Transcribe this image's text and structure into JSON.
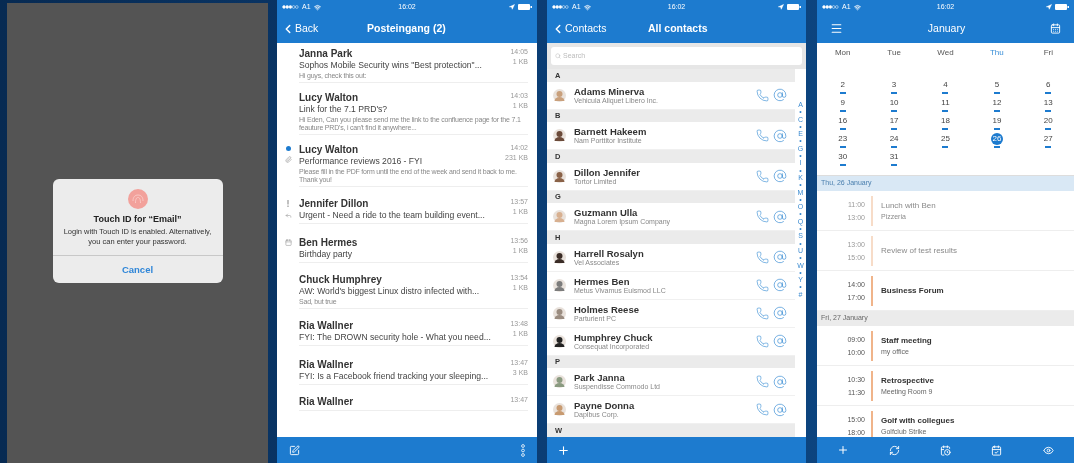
{
  "touch_id_dialog": {
    "title": "Touch ID for “Email”",
    "message": "Login with Touch ID is enabled. Alternatively, you can enter your password.",
    "button": "Cancel"
  },
  "mail": {
    "status_bar": {
      "carrier": "A1",
      "time": "16:02"
    },
    "back": "Back",
    "title": "Posteingang (2)",
    "messages": [
      {
        "sender": "Janna Park",
        "subject": "Sophos Mobile Security wins \"Best protection\"...",
        "preview": "Hi guys, check this out:",
        "time": "14:05",
        "size": "1 KB",
        "unread": false,
        "important": false,
        "attachment": false,
        "replied": false,
        "invitation": false
      },
      {
        "sender": "Lucy Walton",
        "subject": "Link for the 7.1 PRD's?",
        "preview": "Hi Eden, Can you please send me the link to the confluence page for the 7.1 feauture PRD's, i can't find it anywhere...",
        "time": "14:03",
        "size": "1 KB",
        "unread": false,
        "important": false,
        "attachment": false,
        "replied": false,
        "invitation": false
      },
      {
        "sender": "Lucy Walton",
        "subject": "Performance reviews 2016 - FYI",
        "preview": "Please fill in the PDF form until the end of the week and send it back to me. Thank you!",
        "time": "14:02",
        "size": "231 KB",
        "unread": true,
        "important": false,
        "attachment": true,
        "replied": false,
        "invitation": false
      },
      {
        "sender": "Jennifer Dillon",
        "subject": "Urgent - Need a ride to the team building event...",
        "time": "13:57",
        "size": "1 KB",
        "unread": false,
        "important": true,
        "attachment": false,
        "replied": true,
        "invitation": false
      },
      {
        "sender": "Ben Hermes",
        "subject": "Birthday party",
        "time": "13:56",
        "size": "1 KB",
        "unread": false,
        "important": false,
        "attachment": false,
        "replied": false,
        "invitation": true
      },
      {
        "sender": "Chuck Humphrey",
        "subject": "AW: World's biggest Linux distro infected with...",
        "preview": "Sad, but true",
        "time": "13:54",
        "size": "1 KB",
        "unread": false,
        "important": false,
        "attachment": false,
        "replied": false,
        "invitation": false
      },
      {
        "sender": "Ria Wallner",
        "subject": "FYI: The DROWN security hole - What you need...",
        "time": "13:48",
        "size": "1 KB",
        "unread": false,
        "important": false,
        "attachment": false,
        "replied": false,
        "invitation": false
      },
      {
        "sender": "Ria Wallner",
        "subject": "FYI: Is a Facebook friend tracking your sleeping...",
        "time": "13:47",
        "size": "3 KB",
        "unread": false,
        "important": false,
        "attachment": false,
        "replied": false,
        "invitation": false
      },
      {
        "sender": "Ria Wallner",
        "time": "13:47",
        "unread": false,
        "important": false,
        "attachment": false,
        "replied": false,
        "invitation": false
      }
    ]
  },
  "contacts": {
    "status_bar": {
      "carrier": "A1",
      "time": "16:02"
    },
    "back": "Contacts",
    "title": "All contacts",
    "search": {
      "placeholder": "Search"
    },
    "sections": [
      {
        "letter": "A",
        "contacts": [
          {
            "name": "Adams Minerva",
            "company": "Vehicula Aliquet Libero Inc."
          }
        ]
      },
      {
        "letter": "B",
        "contacts": [
          {
            "name": "Barnett Hakeem",
            "company": "Nam Porttitor Institute"
          }
        ]
      },
      {
        "letter": "D",
        "contacts": [
          {
            "name": "Dillon Jennifer",
            "company": "Tortor Limited"
          }
        ]
      },
      {
        "letter": "G",
        "contacts": [
          {
            "name": "Guzmann Ulla",
            "company": "Magna Lorem Ipsum Company"
          }
        ]
      },
      {
        "letter": "H",
        "contacts": [
          {
            "name": "Harrell Rosalyn",
            "company": "Vel Associates"
          },
          {
            "name": "Hermes Ben",
            "company": "Metus Vivamus Euismod LLC"
          },
          {
            "name": "Holmes Reese",
            "company": "Parturient PC"
          },
          {
            "name": "Humphrey Chuck",
            "company": "Consequat Incorporated"
          }
        ]
      },
      {
        "letter": "P",
        "contacts": [
          {
            "name": "Park Janna",
            "company": "Suspendisse Commodo Ltd"
          },
          {
            "name": "Payne Donna",
            "company": "Dapibus Corp."
          }
        ]
      },
      {
        "letter": "W"
      }
    ],
    "index": [
      "A",
      "•",
      "C",
      "•",
      "E",
      "•",
      "G",
      "•",
      "I",
      "•",
      "K",
      "•",
      "M",
      "•",
      "O",
      "•",
      "Q",
      "•",
      "S",
      "•",
      "U",
      "•",
      "W",
      "•",
      "Y",
      "•",
      "#"
    ]
  },
  "calendar": {
    "status_bar": {
      "carrier": "A1",
      "time": "16:02"
    },
    "title": "January",
    "weekdays": [
      {
        "label": "Mon",
        "selected": false
      },
      {
        "label": "Tue",
        "selected": false
      },
      {
        "label": "Wed",
        "selected": false
      },
      {
        "label": "Thu",
        "selected": true
      },
      {
        "label": "Fri",
        "selected": false
      }
    ],
    "weeks": [
      [
        {
          "day": "2",
          "selected": false,
          "has_events": true
        },
        {
          "day": "3",
          "selected": false,
          "has_events": true
        },
        {
          "day": "4",
          "selected": false,
          "has_events": true
        },
        {
          "day": "5",
          "selected": false,
          "has_events": true
        },
        {
          "day": "6",
          "selected": false,
          "has_events": true
        }
      ],
      [
        {
          "day": "9",
          "selected": false,
          "has_events": true
        },
        {
          "day": "10",
          "selected": false,
          "has_events": true
        },
        {
          "day": "11",
          "selected": false,
          "has_events": true
        },
        {
          "day": "12",
          "selected": false,
          "has_events": true
        },
        {
          "day": "13",
          "selected": false,
          "has_events": true
        }
      ],
      [
        {
          "day": "16",
          "selected": false,
          "has_events": true
        },
        {
          "day": "17",
          "selected": false,
          "has_events": true
        },
        {
          "day": "18",
          "selected": false,
          "has_events": true
        },
        {
          "day": "19",
          "selected": false,
          "has_events": true
        },
        {
          "day": "20",
          "selected": false,
          "has_events": true
        }
      ],
      [
        {
          "day": "23",
          "selected": false,
          "has_events": true
        },
        {
          "day": "24",
          "selected": false,
          "has_events": true
        },
        {
          "day": "25",
          "selected": false,
          "has_events": true
        },
        {
          "day": "26",
          "selected": true,
          "has_events": true
        },
        {
          "day": "27",
          "selected": false,
          "has_events": true
        }
      ],
      [
        {
          "day": "30",
          "selected": false,
          "has_events": true
        },
        {
          "day": "31",
          "selected": false,
          "has_events": true
        }
      ]
    ],
    "agenda": [
      {
        "date": "Thu, 26 January",
        "today": true,
        "events": [
          {
            "start": "11:00",
            "end": "13:00",
            "title": "Lunch with Ben",
            "location": "Pizzeria",
            "past": true
          },
          {
            "start": "13:00",
            "end": "15:00",
            "title": "Review of test results",
            "past": true
          },
          {
            "start": "14:00",
            "end": "17:00",
            "title": "Business Forum",
            "past": false
          }
        ]
      },
      {
        "date": "Fri, 27 January",
        "today": false,
        "events": [
          {
            "start": "09:00",
            "end": "10:00",
            "title": "Staff meeting",
            "location": "my office",
            "past": false
          },
          {
            "start": "10:30",
            "end": "11:30",
            "title": "Retrospective",
            "location": "Meeting Room 9",
            "past": false
          },
          {
            "start": "15:00",
            "end": "18:00",
            "title": "Golf with collegues",
            "location": "Golfclub Strike",
            "past": false
          }
        ]
      }
    ]
  }
}
